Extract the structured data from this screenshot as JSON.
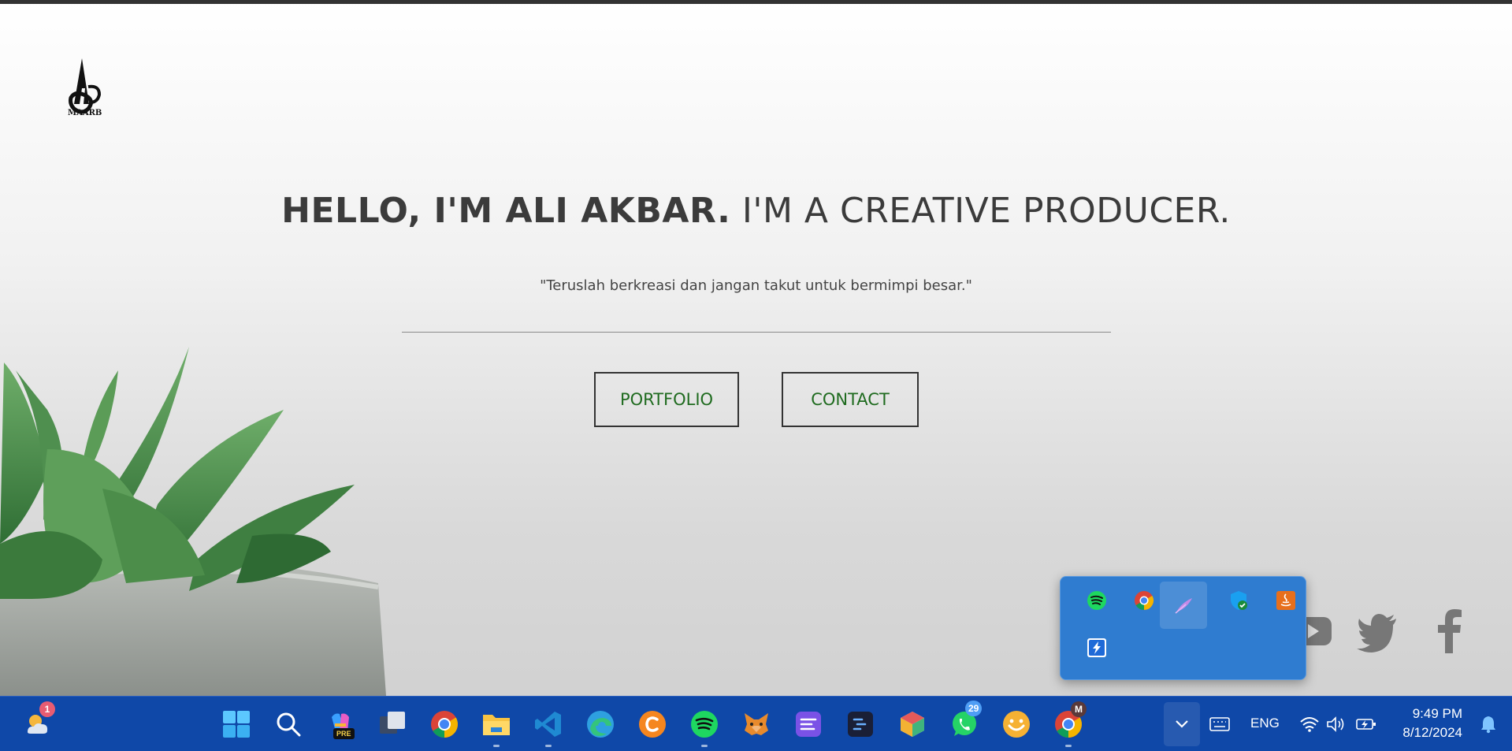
{
  "page": {
    "headline_bold": "HELLO, I'M ALI AKBAR.",
    "headline_light": " I'M A CREATIVE PRODUCER.",
    "quote": "\"Teruslah berkreasi dan jangan takut untuk bermimpi besar.\"",
    "buttons": {
      "portfolio": "PORTFOLIO",
      "contact": "CONTACT"
    },
    "logo": {
      "icon": "maarb-logo-icon",
      "text": "MAARB"
    },
    "social": [
      "youtube-icon",
      "twitter-icon",
      "facebook-icon"
    ]
  },
  "tray_popup": {
    "icons": [
      "spotify-icon",
      "chrome-icon",
      "feather-icon",
      "defender-shield-icon",
      "java-icon",
      "bolt-app-icon"
    ]
  },
  "taskbar": {
    "weather_badge": "1",
    "whatsapp_badge": "29",
    "chrome_profile_badge": "M",
    "copilot_badge": "PRE",
    "apps": [
      "start-icon",
      "search-icon",
      "copilot-icon",
      "task-view-icon",
      "chrome-icon",
      "file-explorer-icon",
      "vscode-icon",
      "edge-icon",
      "c-app-icon",
      "spotify-icon",
      "metamask-icon",
      "notes-app-icon",
      "terminal-icon",
      "cube-app-icon",
      "whatsapp-icon",
      "smile-app-icon",
      "chrome-profile-icon"
    ],
    "language": "ENG",
    "time": "9:49 PM",
    "date": "8/12/2024"
  },
  "colors": {
    "button_text": "#1f6b1f",
    "taskbar": "#0f48a8",
    "tray_popup": "#2f7cd0",
    "headline": "#3b3b3b"
  }
}
